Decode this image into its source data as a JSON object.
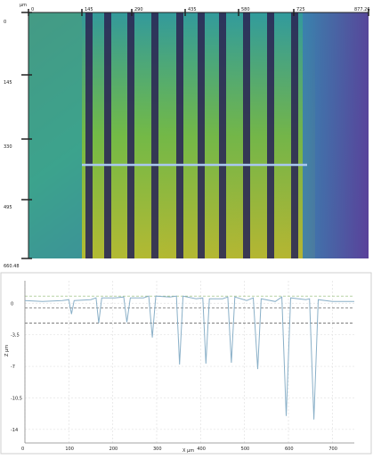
{
  "height_map": {
    "unit": "µm",
    "top_axis_ticks": [
      "0",
      "145",
      "290",
      "435",
      "580",
      "725",
      "877.26"
    ],
    "left_axis_ticks": [
      "0",
      "145",
      "330",
      "495",
      "660.48"
    ],
    "ridges_count": 10
  },
  "chart_data": {
    "type": "line",
    "ylabel": "Z µm",
    "xlabel": "X µm",
    "xlim": [
      0,
      750
    ],
    "ylim": [
      -15.5,
      2.5
    ],
    "x_ticks": [
      "0",
      "100",
      "200",
      "300",
      "400",
      "500",
      "600",
      "700"
    ],
    "y_ticks": [
      "0",
      "-3,5",
      "-7",
      "-10,5",
      "-14"
    ],
    "y_tick_values": [
      0,
      -3.5,
      -7,
      -10.5,
      -14
    ],
    "x_tick_values": [
      0,
      100,
      200,
      300,
      400,
      500,
      600,
      700
    ],
    "reference_lines": [
      0.8,
      -0.5,
      -2.2
    ],
    "series": [
      {
        "values": [
          [
            0,
            0.3
          ],
          [
            40,
            0.2
          ],
          [
            85,
            0.3
          ],
          [
            100,
            0.4
          ],
          [
            106,
            -1.2
          ],
          [
            112,
            0.3
          ],
          [
            150,
            0.4
          ],
          [
            162,
            0.6
          ],
          [
            168,
            -2.2
          ],
          [
            175,
            0.6
          ],
          [
            205,
            0.6
          ],
          [
            225,
            0.7
          ],
          [
            232,
            -2.1
          ],
          [
            240,
            0.6
          ],
          [
            270,
            0.6
          ],
          [
            282,
            0.8
          ],
          [
            290,
            -3.8
          ],
          [
            298,
            0.8
          ],
          [
            330,
            0.7
          ],
          [
            345,
            0.8
          ],
          [
            352,
            -6.8
          ],
          [
            360,
            0.8
          ],
          [
            390,
            0.5
          ],
          [
            405,
            0.6
          ],
          [
            412,
            -6.7
          ],
          [
            420,
            0.5
          ],
          [
            450,
            0.5
          ],
          [
            462,
            0.7
          ],
          [
            470,
            -6.6
          ],
          [
            478,
            0.7
          ],
          [
            505,
            0.3
          ],
          [
            520,
            0.6
          ],
          [
            530,
            -7.3
          ],
          [
            538,
            0.5
          ],
          [
            570,
            0.2
          ],
          [
            585,
            0.7
          ],
          [
            595,
            -12.5
          ],
          [
            605,
            0.6
          ],
          [
            640,
            0.4
          ],
          [
            648,
            0.5
          ],
          [
            658,
            -12.9
          ],
          [
            668,
            0.4
          ],
          [
            700,
            0.2
          ],
          [
            750,
            0.2
          ]
        ]
      }
    ]
  }
}
